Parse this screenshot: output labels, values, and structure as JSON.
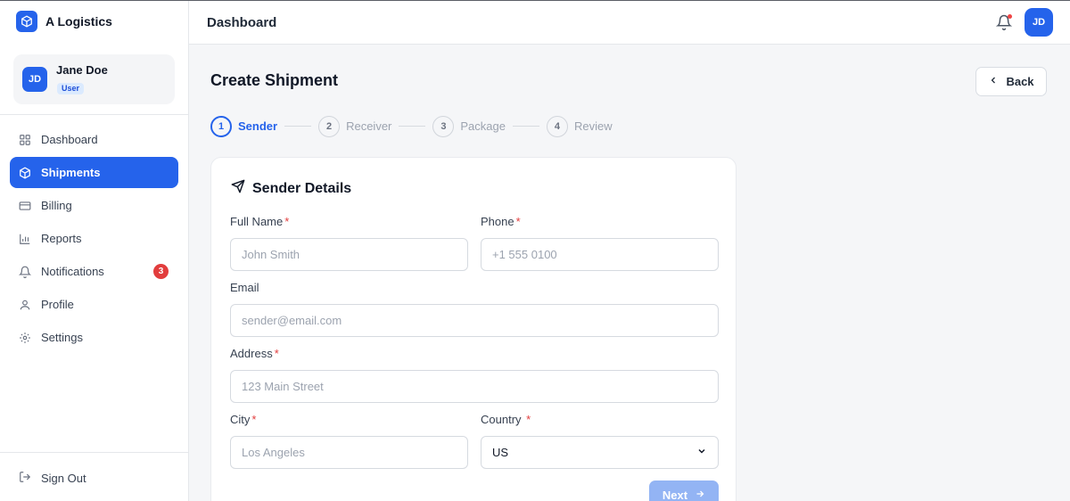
{
  "app": {
    "brand": "A Logistics",
    "accent": "#2563eb"
  },
  "user": {
    "initials": "JD",
    "name": "Jane Doe",
    "role": "User"
  },
  "sidebar": {
    "items": [
      {
        "label": "Dashboard",
        "icon": "grid-icon"
      },
      {
        "label": "Shipments",
        "icon": "box-icon",
        "active": true
      },
      {
        "label": "Billing",
        "icon": "credit-card-icon"
      },
      {
        "label": "Reports",
        "icon": "bar-chart-icon"
      },
      {
        "label": "Notifications",
        "icon": "bell-icon",
        "badge": "3"
      },
      {
        "label": "Profile",
        "icon": "user-icon"
      },
      {
        "label": "Settings",
        "icon": "gear-icon"
      }
    ],
    "signout": "Sign Out"
  },
  "header": {
    "title": "Dashboard",
    "avatar": "JD"
  },
  "page": {
    "title": "Create Shipment",
    "back": "Back"
  },
  "steps": [
    {
      "num": "1",
      "label": "Sender",
      "active": true
    },
    {
      "num": "2",
      "label": "Receiver"
    },
    {
      "num": "3",
      "label": "Package"
    },
    {
      "num": "4",
      "label": "Review"
    }
  ],
  "form": {
    "title": "Sender Details",
    "full_name": {
      "label": "Full Name",
      "required": "*",
      "placeholder": "John Smith",
      "value": ""
    },
    "phone": {
      "label": "Phone",
      "required": "*",
      "placeholder": "+1 555 0100",
      "value": ""
    },
    "email": {
      "label": "Email",
      "placeholder": "sender@email.com",
      "value": ""
    },
    "address": {
      "label": "Address",
      "required": "*",
      "placeholder": "123 Main Street",
      "value": ""
    },
    "city": {
      "label": "City",
      "required": "*",
      "placeholder": "Los Angeles",
      "value": ""
    },
    "country": {
      "label": "Country",
      "required": "*",
      "value": "US"
    },
    "next": "Next"
  }
}
